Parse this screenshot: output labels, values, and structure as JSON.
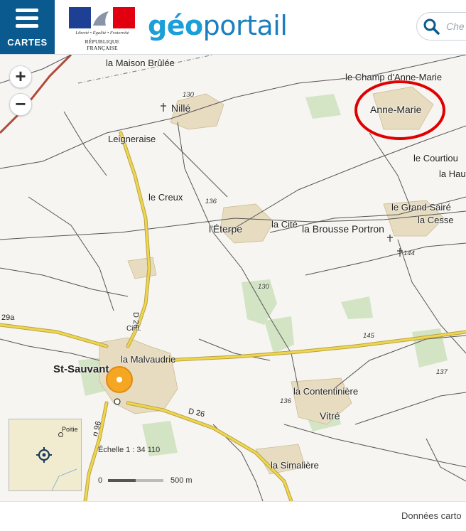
{
  "header": {
    "menu_label": "CARTES",
    "rf_motto": "Liberté • Égalité • Fraternité",
    "rf_name": "RÉPUBLIQUE FRANÇAISE",
    "logo_geo": "géo",
    "logo_portail": "portail",
    "search_placeholder": "Che"
  },
  "map": {
    "places": {
      "la_maison_brulee": "la Maison Brûlée",
      "le_champ_anne_marie": "le Champ d'Anne-Marie",
      "anne_marie": "Anne-Marie",
      "nille": "Nillé",
      "leigneraise": "Leigneraise",
      "le_courtiou": "le Courtiou",
      "la_haut": "la Haut",
      "le_creux": "le Creux",
      "le_grand_saire": "le Grand Sairé",
      "la_cesse": "la Cesse",
      "l_eterpe": "l'Éterpe",
      "la_cite": "la Cité",
      "la_brousse_portron": "la Brousse Portron",
      "cim": "Cim.",
      "la_malvaudrie": "la Malvaudrie",
      "st_sauvant": "St-Sauvant",
      "la_contentiniere": "la Contentinière",
      "vitre": "Vitré",
      "la_simaliere": "la Simalière"
    },
    "altitudes": {
      "a130_top": "130",
      "a136_mid": "136",
      "a144": "144",
      "a130_mid": "130",
      "a145": "145",
      "a137": "137",
      "a136_low": "136"
    },
    "roads": {
      "d26_vertical": "D 26",
      "d26_east": "D 26",
      "r29a": "29a",
      "n96": "n 96"
    },
    "controls": {
      "zoom_in": "+",
      "zoom_out": "−"
    },
    "overview": {
      "city": "Poitie"
    },
    "scale": {
      "label": "Échelle 1 : 34 110",
      "zero": "0",
      "end": "500 m"
    },
    "colors": {
      "main_road": "#f0d64a",
      "highlight_circle": "#e00000",
      "location_marker": "#f5a623"
    }
  },
  "footer": {
    "attribution": "Données carto"
  }
}
